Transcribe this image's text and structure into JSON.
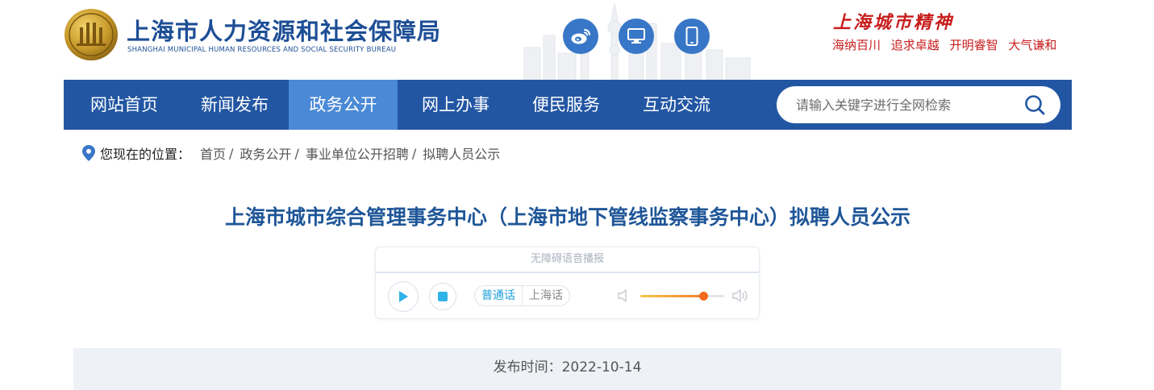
{
  "header": {
    "org_name_cn": "上海市人力资源和社会保障局",
    "org_name_en": "SHANGHAI MUNICIPAL HUMAN RESOURCES AND SOCIAL SECURITY BUREAU",
    "icons": [
      "weibo-icon",
      "desktop-icon",
      "mobile-icon"
    ],
    "spirit_title": "上海城市精神",
    "spirit_phrases": [
      "海纳百川",
      "追求卓越",
      "开明睿智",
      "大气谦和"
    ]
  },
  "nav": {
    "items": [
      {
        "label": "网站首页",
        "active": false
      },
      {
        "label": "新闻发布",
        "active": false
      },
      {
        "label": "政务公开",
        "active": true
      },
      {
        "label": "网上办事",
        "active": false
      },
      {
        "label": "便民服务",
        "active": false
      },
      {
        "label": "互动交流",
        "active": false
      }
    ],
    "search_placeholder": "请输入关键字进行全网检索"
  },
  "breadcrumb": {
    "prefix": "您现在的位置：",
    "items": [
      "首页",
      "政务公开",
      "事业单位公开招聘",
      "拟聘人员公示"
    ],
    "separator": "/"
  },
  "article": {
    "title": "上海市城市综合管理事务中心（上海市地下管线监察事务中心）拟聘人员公示",
    "publish_time": "发布时间：2022-10-14"
  },
  "player": {
    "header": "无障碍语音播报",
    "languages": [
      "普通话",
      "上海话"
    ],
    "selected_language": "普通话",
    "volume_percent": 75
  },
  "colors": {
    "nav_bg": "#2256a3",
    "nav_active": "#4a89d6",
    "title": "#1f5698",
    "spirit_red": "#c81d1d",
    "accent_cyan": "#1ea0d8",
    "volume_orange": "#f26a1b"
  }
}
